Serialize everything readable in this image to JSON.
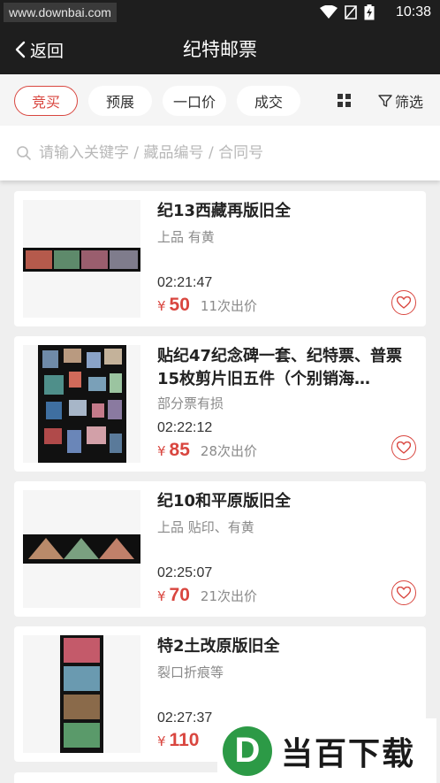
{
  "status_bar": {
    "watermark_url": "www.downbai.com",
    "time": "10:38",
    "icons": [
      "wifi-icon",
      "no-sim-icon",
      "battery-charging-icon"
    ]
  },
  "nav": {
    "back_label": "返回",
    "title": "纪特邮票"
  },
  "filters": {
    "tabs": [
      {
        "label": "竞买",
        "active": true
      },
      {
        "label": "预展",
        "active": false
      },
      {
        "label": "一口价",
        "active": false
      },
      {
        "label": "成交",
        "active": false
      }
    ],
    "view_icon": "grid-view-icon",
    "filter_label": "筛选"
  },
  "search": {
    "placeholder": "请输入关键字 / 藏品编号 / 合同号",
    "value": ""
  },
  "listings": [
    {
      "title": "纪13西藏再版旧全",
      "desc": "上品 有黄",
      "time": "02:21:47",
      "currency": "¥",
      "price": "50",
      "bids": "11次出价"
    },
    {
      "title": "贴纪47纪念碑一套、纪特票、普票15枚剪片旧五件（个别销海…",
      "desc": "部分票有损",
      "time": "02:22:12",
      "currency": "¥",
      "price": "85",
      "bids": "28次出价"
    },
    {
      "title": "纪10和平原版旧全",
      "desc": "上品 贴印、有黄",
      "time": "02:25:07",
      "currency": "¥",
      "price": "70",
      "bids": "21次出价"
    },
    {
      "title": "特2土改原版旧全",
      "desc": "裂口折痕等",
      "time": "02:27:37",
      "currency": "¥",
      "price": "110",
      "bids": ""
    }
  ],
  "watermark_badge": {
    "logo_letter": "D",
    "text": "当百下载"
  },
  "colors": {
    "accent": "#d9463f",
    "header_bg": "#1e1e1e",
    "page_bg": "#efefef"
  }
}
